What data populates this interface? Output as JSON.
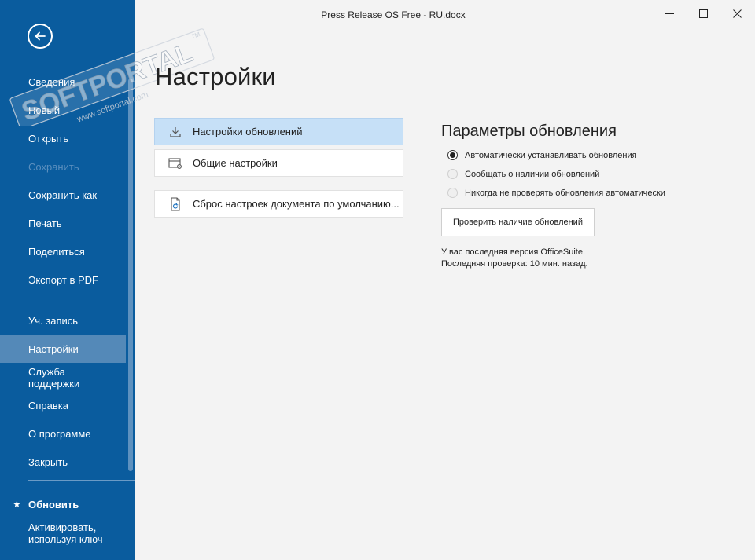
{
  "window": {
    "title": "Press Release OS Free - RU.docx",
    "minimize_icon": "minimize-icon",
    "maximize_icon": "maximize-icon",
    "close_icon": "close-icon"
  },
  "watermark": {
    "brand": "SOFTPORTAL",
    "tm": "TM",
    "url": "www.softportal.com"
  },
  "sidebar": {
    "back_icon": "arrow-left-icon",
    "items": [
      {
        "label": "Сведения"
      },
      {
        "label": "Новый"
      },
      {
        "label": "Открыть"
      },
      {
        "label": "Сохранить"
      },
      {
        "label": "Сохранить как"
      },
      {
        "label": "Печать"
      },
      {
        "label": "Поделиться"
      },
      {
        "label": "Экспорт в PDF"
      },
      {
        "label": "Уч. запись"
      },
      {
        "label": "Настройки"
      },
      {
        "label_line1": "Служба",
        "label_line2": "поддержки"
      },
      {
        "label": "Справка"
      },
      {
        "label": "О программе"
      },
      {
        "label": "Закрыть"
      }
    ],
    "upgrade": {
      "label": "Обновить",
      "icon": "star-icon"
    },
    "activate": {
      "label_line1": "Активировать,",
      "label_line2": "используя ключ"
    },
    "colors": {
      "background": "#0a5c9e",
      "active": "#5489b8",
      "disabled_text": "#5b8fbe"
    }
  },
  "main": {
    "title": "Настройки",
    "cards": [
      {
        "label": "Настройки обновлений",
        "icon": "download-icon",
        "selected": true
      },
      {
        "label": "Общие настройки",
        "icon": "window-gear-icon",
        "selected": false
      },
      {
        "label": "Сброс настроек документа по умолчанию...",
        "icon": "document-reset-icon",
        "selected": false
      }
    ]
  },
  "update_panel": {
    "title": "Параметры обновления",
    "options": [
      {
        "label": "Автоматически устанавливать обновления",
        "selected": true
      },
      {
        "label": "Сообщать о наличии обновлений",
        "selected": false
      },
      {
        "label": "Никогда не проверять обновления автоматически",
        "selected": false
      }
    ],
    "check_button": "Проверить наличие обновлений",
    "status_line1": "У вас последняя версия OfficeSuite.",
    "status_line2": "Последняя проверка: 10 мин. назад."
  }
}
